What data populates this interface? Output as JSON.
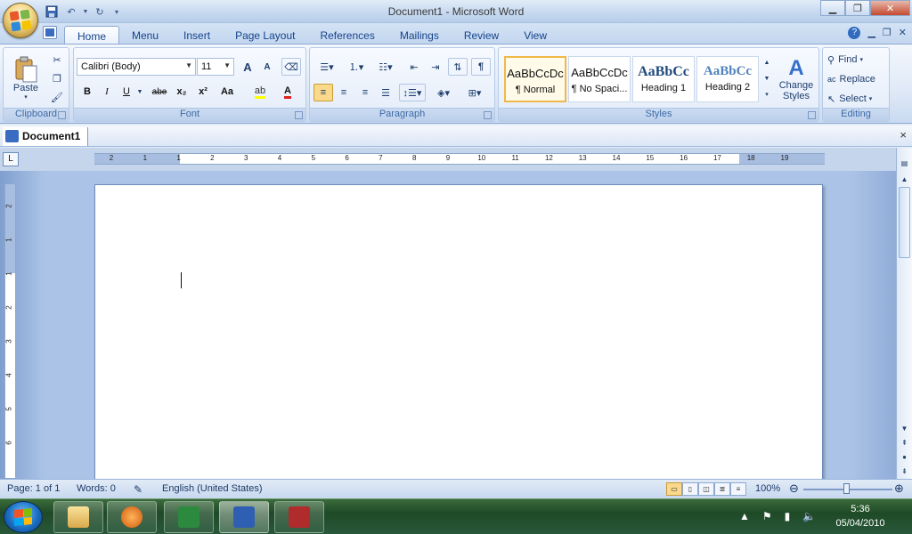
{
  "window": {
    "title": "Document1 - Microsoft Word",
    "minimize_icon": "minimize-icon",
    "maximize_icon": "restore-icon",
    "close_icon": "close-icon"
  },
  "qat": [
    "save-icon",
    "undo-icon",
    "redo-icon",
    "customize-icon"
  ],
  "tabs": [
    "Home",
    "Menu",
    "Insert",
    "Page Layout",
    "References",
    "Mailings",
    "Review",
    "View"
  ],
  "active_tab": "Home",
  "ribbon": {
    "clipboard": {
      "label": "Clipboard",
      "paste": "Paste"
    },
    "font": {
      "label": "Font",
      "name": "Calibri (Body)",
      "size": "11",
      "buttons": {
        "grow": "A",
        "shrink": "A",
        "bold": "B",
        "italic": "I",
        "underline": "U",
        "strike": "abe",
        "subscript": "x₂",
        "superscript": "x²",
        "change_case": "Aa"
      }
    },
    "paragraph": {
      "label": "Paragraph"
    },
    "styles": {
      "label": "Styles",
      "change_styles": "Change Styles",
      "items": [
        {
          "sample": "AaBbCcDc",
          "name": "¶ Normal"
        },
        {
          "sample": "AaBbCcDc",
          "name": "¶ No Spaci..."
        },
        {
          "sample": "AaBbCc",
          "name": "Heading 1"
        },
        {
          "sample": "AaBbCc",
          "name": "Heading 2"
        }
      ]
    },
    "editing": {
      "label": "Editing",
      "find": "Find",
      "replace": "Replace",
      "select": "Select"
    }
  },
  "document": {
    "tab": "Document1",
    "close": "×"
  },
  "ruler": {
    "marks": [
      "2",
      "1",
      "1",
      "2",
      "3",
      "4",
      "5",
      "6",
      "7",
      "8",
      "9",
      "10",
      "11",
      "12",
      "13",
      "14",
      "15",
      "16",
      "17",
      "18",
      "19"
    ],
    "vmarks": [
      "2",
      "1",
      "1",
      "2",
      "3",
      "4",
      "5",
      "6"
    ],
    "tab_selector": "L"
  },
  "status": {
    "page": "Page: 1 of 1",
    "words": "Words: 0",
    "language": "English (United States)",
    "zoom": "100%",
    "zoom_level": 1.0
  },
  "taskbar": {
    "time": "5:36",
    "date": "05/04/2010",
    "apps": [
      "explorer-icon",
      "media-player-icon",
      "excel-icon",
      "word-icon",
      "access-icon"
    ]
  },
  "colors": {
    "accent": "#15428b",
    "ribbon": "#dfe9f7",
    "taskbar": "#1f4a27"
  }
}
